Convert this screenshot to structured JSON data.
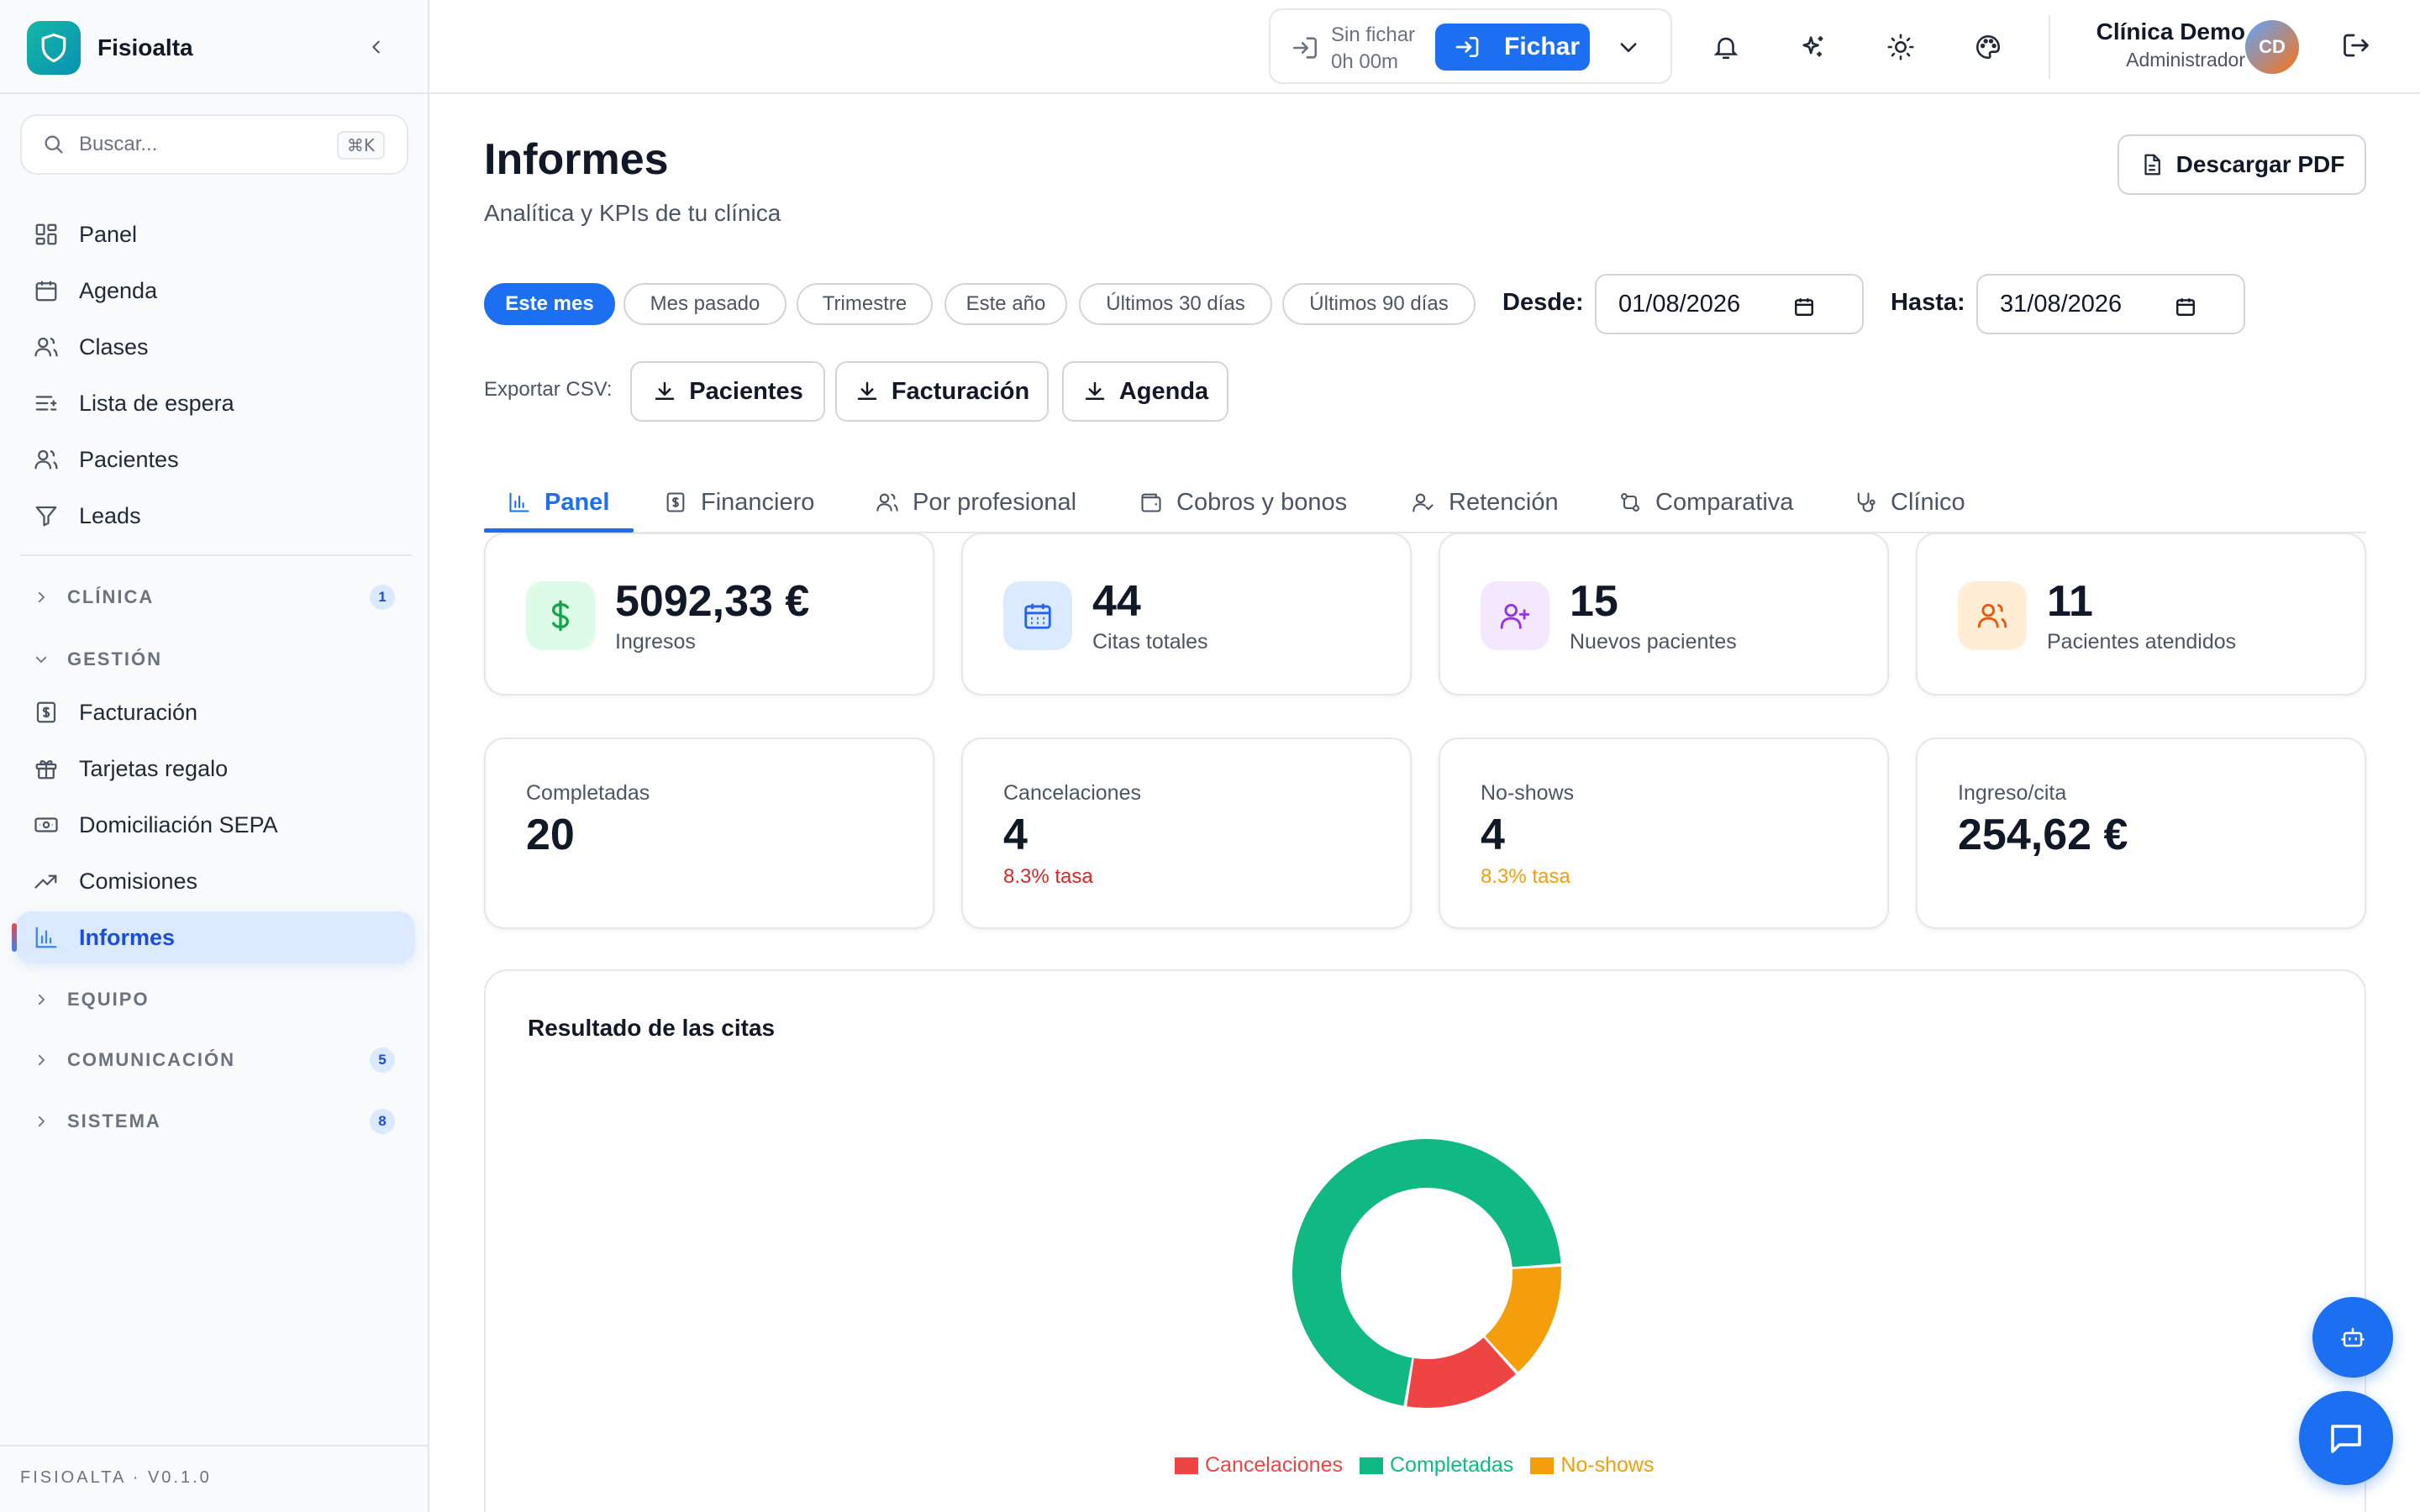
{
  "app": {
    "name": "Fisioalta",
    "version": "FISIOALTA · V0.1.0"
  },
  "search": {
    "placeholder": "Buscar...",
    "shortcut": "⌘K"
  },
  "sidebar": {
    "items": [
      {
        "label": "Panel",
        "icon": "grid-icon"
      },
      {
        "label": "Agenda",
        "icon": "calendar-icon"
      },
      {
        "label": "Clases",
        "icon": "users-icon"
      },
      {
        "label": "Lista de espera",
        "icon": "list-icon"
      },
      {
        "label": "Pacientes",
        "icon": "users-icon"
      },
      {
        "label": "Leads",
        "icon": "filter-icon"
      }
    ],
    "sections": {
      "clinica": {
        "label": "CLÍNICA",
        "badge": "1",
        "expanded": false
      },
      "gestion": {
        "label": "GESTIÓN",
        "expanded": true
      },
      "equipo": {
        "label": "EQUIPO",
        "expanded": false
      },
      "comunicacion": {
        "label": "COMUNICACIÓN",
        "badge": "5",
        "expanded": false
      },
      "sistema": {
        "label": "SISTEMA",
        "badge": "8",
        "expanded": false
      }
    },
    "gestion_items": [
      {
        "label": "Facturación",
        "icon": "invoice-icon"
      },
      {
        "label": "Tarjetas regalo",
        "icon": "gift-icon"
      },
      {
        "label": "Domiciliación SEPA",
        "icon": "banknote-icon"
      },
      {
        "label": "Comisiones",
        "icon": "trending-up-icon"
      },
      {
        "label": "Informes",
        "icon": "bar-chart-icon",
        "active": true
      }
    ]
  },
  "topbar": {
    "clock_status_1": "Sin fichar",
    "clock_status_2": "0h 00m",
    "fichar_label": "Fichar",
    "user_name": "Clínica Demo",
    "user_role": "Administrador",
    "avatar_initials": "CD"
  },
  "page": {
    "title": "Informes",
    "subtitle": "Analítica y KPIs de tu clínica",
    "download_pdf": "Descargar PDF"
  },
  "filters": {
    "ranges": [
      "Este mes",
      "Mes pasado",
      "Trimestre",
      "Este año",
      "Últimos 30 días",
      "Últimos 90 días"
    ],
    "active_range": "Este mes",
    "from_label": "Desde:",
    "from_value": "01/08/2026",
    "to_label": "Hasta:",
    "to_value": "31/08/2026"
  },
  "export": {
    "label": "Exportar CSV:",
    "buttons": [
      "Pacientes",
      "Facturación",
      "Agenda"
    ]
  },
  "tabs": [
    "Panel",
    "Financiero",
    "Por profesional",
    "Cobros y bonos",
    "Retención",
    "Comparativa",
    "Clínico"
  ],
  "active_tab": "Panel",
  "kpis": [
    {
      "value": "5092,33 €",
      "label": "Ingresos",
      "icon": "dollar-icon",
      "color": "#16a34a"
    },
    {
      "value": "44",
      "label": "Citas totales",
      "icon": "calendar-icon",
      "color": "#2563eb"
    },
    {
      "value": "15",
      "label": "Nuevos pacientes",
      "icon": "user-plus-icon",
      "color": "#9333ea"
    },
    {
      "value": "11",
      "label": "Pacientes atendidos",
      "icon": "users-icon",
      "color": "#ea580c"
    }
  ],
  "stats": [
    {
      "label": "Completadas",
      "value": "20",
      "rate": ""
    },
    {
      "label": "Cancelaciones",
      "value": "4",
      "rate": "8.3% tasa",
      "rate_color": "#dc2626"
    },
    {
      "label": "No-shows",
      "value": "4",
      "rate": "8.3% tasa",
      "rate_color": "#f59e0b"
    },
    {
      "label": "Ingreso/cita",
      "value": "254,62 €",
      "rate": ""
    }
  ],
  "chart": {
    "title": "Resultado de las citas"
  },
  "chart_data": {
    "type": "pie",
    "variant": "donut",
    "title": "Resultado de las citas",
    "categories": [
      "Cancelaciones",
      "Completadas",
      "No-shows"
    ],
    "values": [
      4,
      20,
      4
    ],
    "colors": [
      "#ef4444",
      "#10b981",
      "#f59e0b"
    ],
    "legend": "bottom"
  },
  "colors": {
    "accent": "#1d6ff2",
    "completed": "#10b981",
    "cancelled": "#ef4444",
    "noshow": "#f59e0b"
  }
}
